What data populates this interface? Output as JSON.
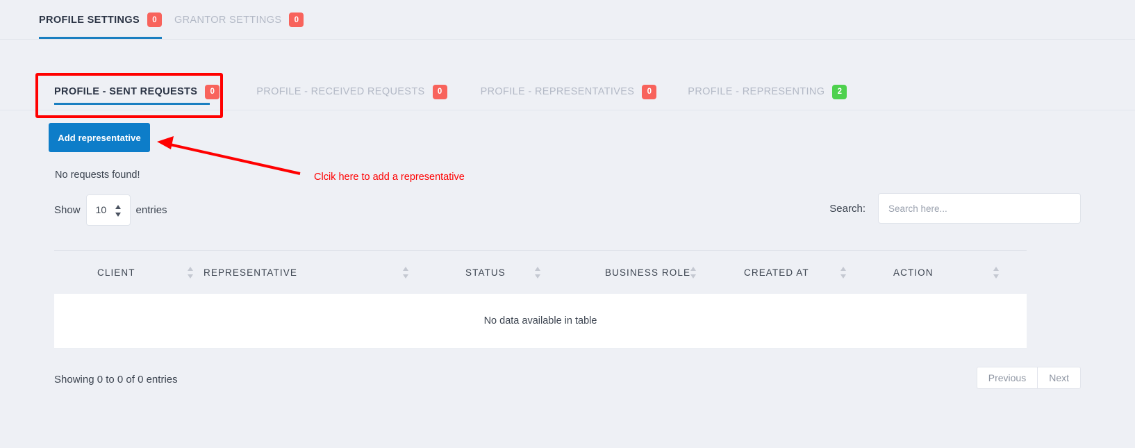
{
  "top_tabs": [
    {
      "label": "PROFILE SETTINGS",
      "badge": "0",
      "badge_color": "#f8635c",
      "active": true
    },
    {
      "label": "GRANTOR SETTINGS",
      "badge": "0",
      "badge_color": "#f8635c",
      "active": false
    }
  ],
  "sub_tabs": [
    {
      "label": "PROFILE - SENT REQUESTS",
      "badge": "0",
      "badge_color": "#f8635c",
      "active": true
    },
    {
      "label": "PROFILE - RECEIVED REQUESTS",
      "badge": "0",
      "badge_color": "#f8635c",
      "active": false
    },
    {
      "label": "PROFILE - REPRESENTATIVES",
      "badge": "0",
      "badge_color": "#f8635c",
      "active": false
    },
    {
      "label": "PROFILE - REPRESENTING",
      "badge": "2",
      "badge_color": "#4ed14e",
      "active": false
    }
  ],
  "toolbar": {
    "add_representative_label": "Add representative",
    "add_button_color": "#0d7dc9"
  },
  "messages": {
    "no_requests": "No requests found!",
    "empty_table": "No data available in table"
  },
  "length_menu": {
    "prefix": "Show",
    "value": "10",
    "suffix": "entries"
  },
  "search": {
    "label": "Search:",
    "value": "",
    "placeholder": "Search here..."
  },
  "table": {
    "columns": [
      "CLIENT",
      "REPRESENTATIVE",
      "STATUS",
      "BUSINESS ROLE",
      "CREATED AT",
      "ACTION"
    ],
    "rows": []
  },
  "footer": {
    "showing_info": "Showing 0 to 0 of 0 entries",
    "previous_label": "Previous",
    "next_label": "Next"
  },
  "annotations": {
    "callout_text": "Clcik here to add a representative",
    "color": "#ff0000"
  }
}
